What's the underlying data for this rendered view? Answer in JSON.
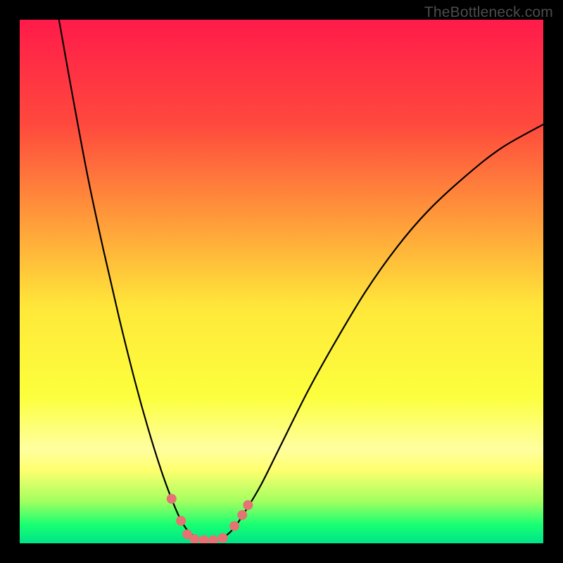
{
  "watermark": "TheBottleneck.com",
  "chart_data": {
    "type": "line",
    "title": "",
    "xlabel": "",
    "ylabel": "",
    "xlim": [
      0,
      100
    ],
    "ylim": [
      0,
      100
    ],
    "background_gradient": {
      "stops": [
        {
          "offset": 0.0,
          "color": "#ff1b4a"
        },
        {
          "offset": 0.2,
          "color": "#ff493d"
        },
        {
          "offset": 0.4,
          "color": "#ffa33a"
        },
        {
          "offset": 0.55,
          "color": "#ffe83a"
        },
        {
          "offset": 0.72,
          "color": "#fcff3d"
        },
        {
          "offset": 0.82,
          "color": "#ffffa0"
        },
        {
          "offset": 0.86,
          "color": "#ffff6f"
        },
        {
          "offset": 0.92,
          "color": "#a2ff60"
        },
        {
          "offset": 0.965,
          "color": "#17ff72"
        },
        {
          "offset": 1.0,
          "color": "#00e38a"
        }
      ]
    },
    "series": [
      {
        "name": "bottleneck-curve",
        "stroke": "#000000",
        "stroke_width": 2.2,
        "points": [
          {
            "x": 7.5,
            "y": 100.0
          },
          {
            "x": 10.0,
            "y": 86.0
          },
          {
            "x": 13.0,
            "y": 70.0
          },
          {
            "x": 16.0,
            "y": 56.0
          },
          {
            "x": 19.0,
            "y": 43.0
          },
          {
            "x": 22.0,
            "y": 31.0
          },
          {
            "x": 24.5,
            "y": 22.0
          },
          {
            "x": 27.0,
            "y": 14.0
          },
          {
            "x": 29.0,
            "y": 8.5
          },
          {
            "x": 30.5,
            "y": 5.0
          },
          {
            "x": 32.0,
            "y": 2.5
          },
          {
            "x": 33.5,
            "y": 1.2
          },
          {
            "x": 35.0,
            "y": 0.6
          },
          {
            "x": 37.0,
            "y": 0.6
          },
          {
            "x": 39.0,
            "y": 1.2
          },
          {
            "x": 41.0,
            "y": 3.0
          },
          {
            "x": 43.0,
            "y": 6.0
          },
          {
            "x": 46.0,
            "y": 11.0
          },
          {
            "x": 50.0,
            "y": 19.0
          },
          {
            "x": 55.0,
            "y": 29.0
          },
          {
            "x": 60.0,
            "y": 38.0
          },
          {
            "x": 66.0,
            "y": 48.0
          },
          {
            "x": 72.0,
            "y": 56.5
          },
          {
            "x": 78.0,
            "y": 63.5
          },
          {
            "x": 85.0,
            "y": 70.0
          },
          {
            "x": 92.0,
            "y": 75.5
          },
          {
            "x": 100.0,
            "y": 80.0
          }
        ]
      }
    ],
    "marker_style": {
      "fill": "#e57373",
      "r": 7
    },
    "markers": [
      {
        "x": 29.0,
        "y": 8.5
      },
      {
        "x": 30.8,
        "y": 4.3
      },
      {
        "x": 32.0,
        "y": 1.7
      },
      {
        "x": 33.4,
        "y": 0.8
      },
      {
        "x": 35.2,
        "y": 0.6
      },
      {
        "x": 37.0,
        "y": 0.6
      },
      {
        "x": 38.8,
        "y": 1.0
      },
      {
        "x": 41.0,
        "y": 3.3
      },
      {
        "x": 42.5,
        "y": 5.4
      },
      {
        "x": 43.6,
        "y": 7.3
      }
    ]
  }
}
